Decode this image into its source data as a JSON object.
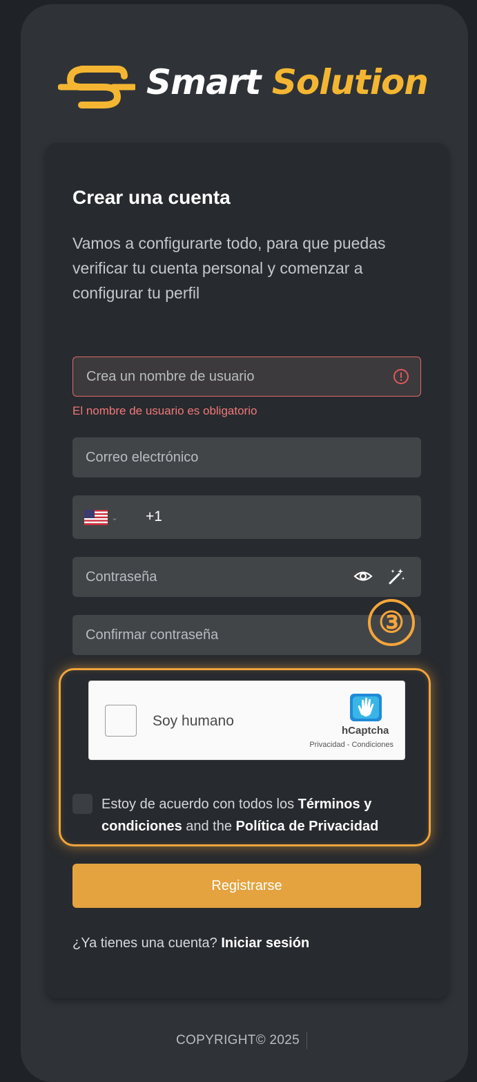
{
  "brand": {
    "word1": "Smart",
    "word2": "Solution",
    "accent_color": "#f4b632"
  },
  "form": {
    "title": "Crear una cuenta",
    "subtitle": "Vamos a configurarte todo, para que puedas verificar tu cuenta personal y comenzar a configurar tu perfil",
    "username": {
      "placeholder": "Crea un nombre de usuario",
      "value": "",
      "error": "El nombre de usuario es obligatorio",
      "error_icon": "alert-circle-icon"
    },
    "email": {
      "placeholder": "Correo electrónico",
      "value": ""
    },
    "phone": {
      "country_flag": "us-flag-icon",
      "dial_code": "+1",
      "value": ""
    },
    "password": {
      "placeholder": "Contraseña",
      "value": "",
      "icons": [
        "eye-icon",
        "magic-wand-icon"
      ]
    },
    "confirm_password": {
      "placeholder": "Confirmar contraseña",
      "value": ""
    },
    "step_badge": "③",
    "captcha": {
      "label": "Soy humano",
      "brand": "hCaptcha",
      "links": "Privacidad - Condiciones",
      "checked": false
    },
    "terms": {
      "checked": false,
      "prefix": "Estoy de acuerdo con todos los ",
      "terms_link": "Términos y condiciones",
      "middle": " and the ",
      "privacy_link": "Política de Privacidad"
    },
    "submit_label": "Registrarse",
    "login_prompt": "¿Ya tienes una cuenta?",
    "login_link": "Iniciar sesión"
  },
  "footer": {
    "copyright": "COPYRIGHT© 2025"
  },
  "colors": {
    "primary_button": "#e4a33f",
    "highlight": "#f2a43d",
    "error": "#f0787a"
  }
}
